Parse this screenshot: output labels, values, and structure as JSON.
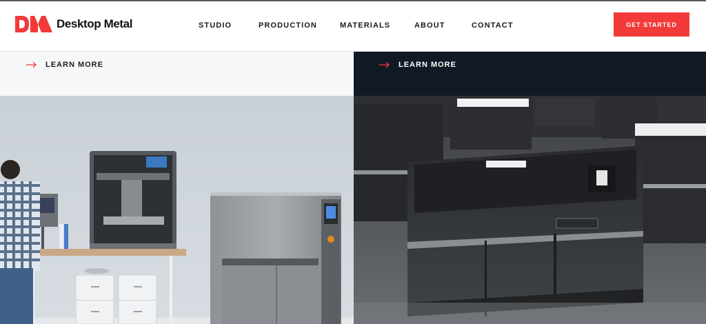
{
  "brand": {
    "name": "Desktop Metal",
    "logo_icon": "dm-logo-icon",
    "accent": "#f23a3a"
  },
  "nav": {
    "items": [
      {
        "label": "STUDIO"
      },
      {
        "label": "PRODUCTION"
      },
      {
        "label": "MATERIALS"
      },
      {
        "label": "ABOUT"
      },
      {
        "label": "CONTACT"
      }
    ]
  },
  "cta": {
    "label": "GET STARTED"
  },
  "panels": {
    "left": {
      "link_label": "LEARN MORE",
      "icon": "arrow-right-icon",
      "image": "studio-system-photo"
    },
    "right": {
      "link_label": "LEARN MORE",
      "icon": "arrow-right-icon",
      "image": "production-system-photo"
    }
  },
  "colors": {
    "header_bg": "#ffffff",
    "left_band": "#f6f7f9",
    "right_band": "#111a24",
    "text_dark": "#1a1a1a"
  }
}
